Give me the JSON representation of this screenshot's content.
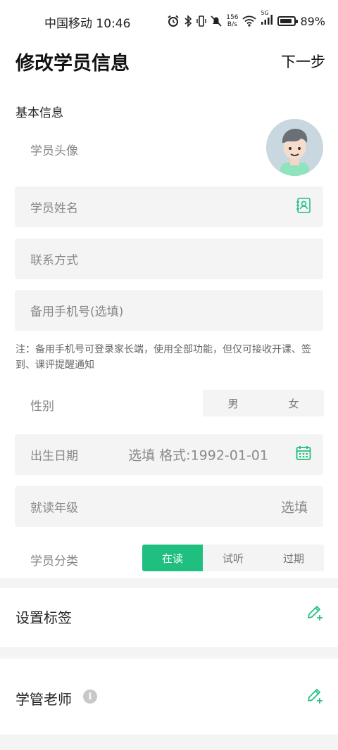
{
  "status_bar": {
    "carrier_time": "中国移动 10:46",
    "net_speed_value": "156",
    "net_speed_unit": "B/s",
    "network_type": "5G",
    "battery": "89%"
  },
  "header": {
    "title": "修改学员信息",
    "next_label": "下一步"
  },
  "basic_info": {
    "section_label": "基本信息",
    "avatar_label": "学员头像",
    "name_placeholder": "学员姓名",
    "contact_placeholder": "联系方式",
    "backup_phone_placeholder": "备用手机号(选填)",
    "note": "注：备用手机号可登录家长端，使用全部功能，但仅可接收开课、签到、课评提醒通知"
  },
  "gender": {
    "label": "性别",
    "options": [
      "男",
      "女"
    ]
  },
  "birthday": {
    "label": "出生日期",
    "placeholder": "选填 格式:1992-01-01"
  },
  "grade": {
    "label": "就读年级",
    "placeholder": "选填"
  },
  "category": {
    "label": "学员分类",
    "options": [
      "在读",
      "试听",
      "过期"
    ],
    "selected": "在读"
  },
  "tags": {
    "label": "设置标签"
  },
  "teacher": {
    "label": "学管老师",
    "info_glyph": "i"
  },
  "colors": {
    "accent": "#1fbf80",
    "field_bg": "#f4f4f4"
  }
}
